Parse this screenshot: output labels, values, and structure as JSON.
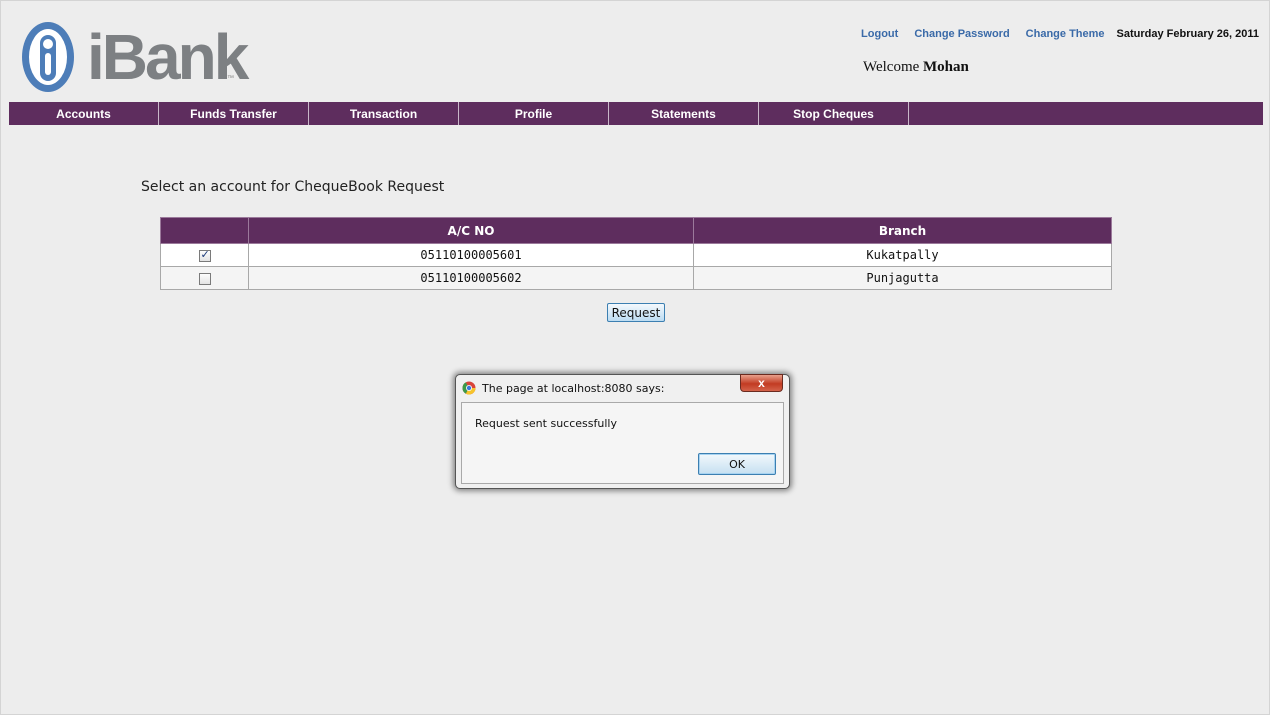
{
  "brand": {
    "name": "iBank",
    "tm": "™"
  },
  "header": {
    "links": [
      {
        "label": "Logout"
      },
      {
        "label": "Change Password"
      },
      {
        "label": "Change Theme"
      }
    ],
    "date": "Saturday February 26, 2011",
    "welcome_prefix": "Welcome",
    "user": "Mohan"
  },
  "nav": {
    "items": [
      {
        "label": "Accounts"
      },
      {
        "label": "Funds Transfer"
      },
      {
        "label": "Transaction"
      },
      {
        "label": "Profile"
      },
      {
        "label": "Statements"
      },
      {
        "label": "Stop Cheques"
      }
    ]
  },
  "main": {
    "heading": "Select an account for ChequeBook Request",
    "table": {
      "headers": [
        "",
        "A/C NO",
        "Branch"
      ],
      "rows": [
        {
          "checked": true,
          "acno": "05110100005601",
          "branch": "Kukatpally"
        },
        {
          "checked": false,
          "acno": "05110100005602",
          "branch": "Punjagutta"
        }
      ]
    },
    "request_label": "Request"
  },
  "dialog": {
    "title": "The page at localhost:8080 says:",
    "message": "Request sent successfully",
    "ok_label": "OK",
    "close_glyph": "x"
  },
  "colors": {
    "brand_purple": "#5e2d5e",
    "logo_blue": "#4d7db8",
    "logo_gray": "#7d8083",
    "link_blue": "#3a6aa8"
  }
}
